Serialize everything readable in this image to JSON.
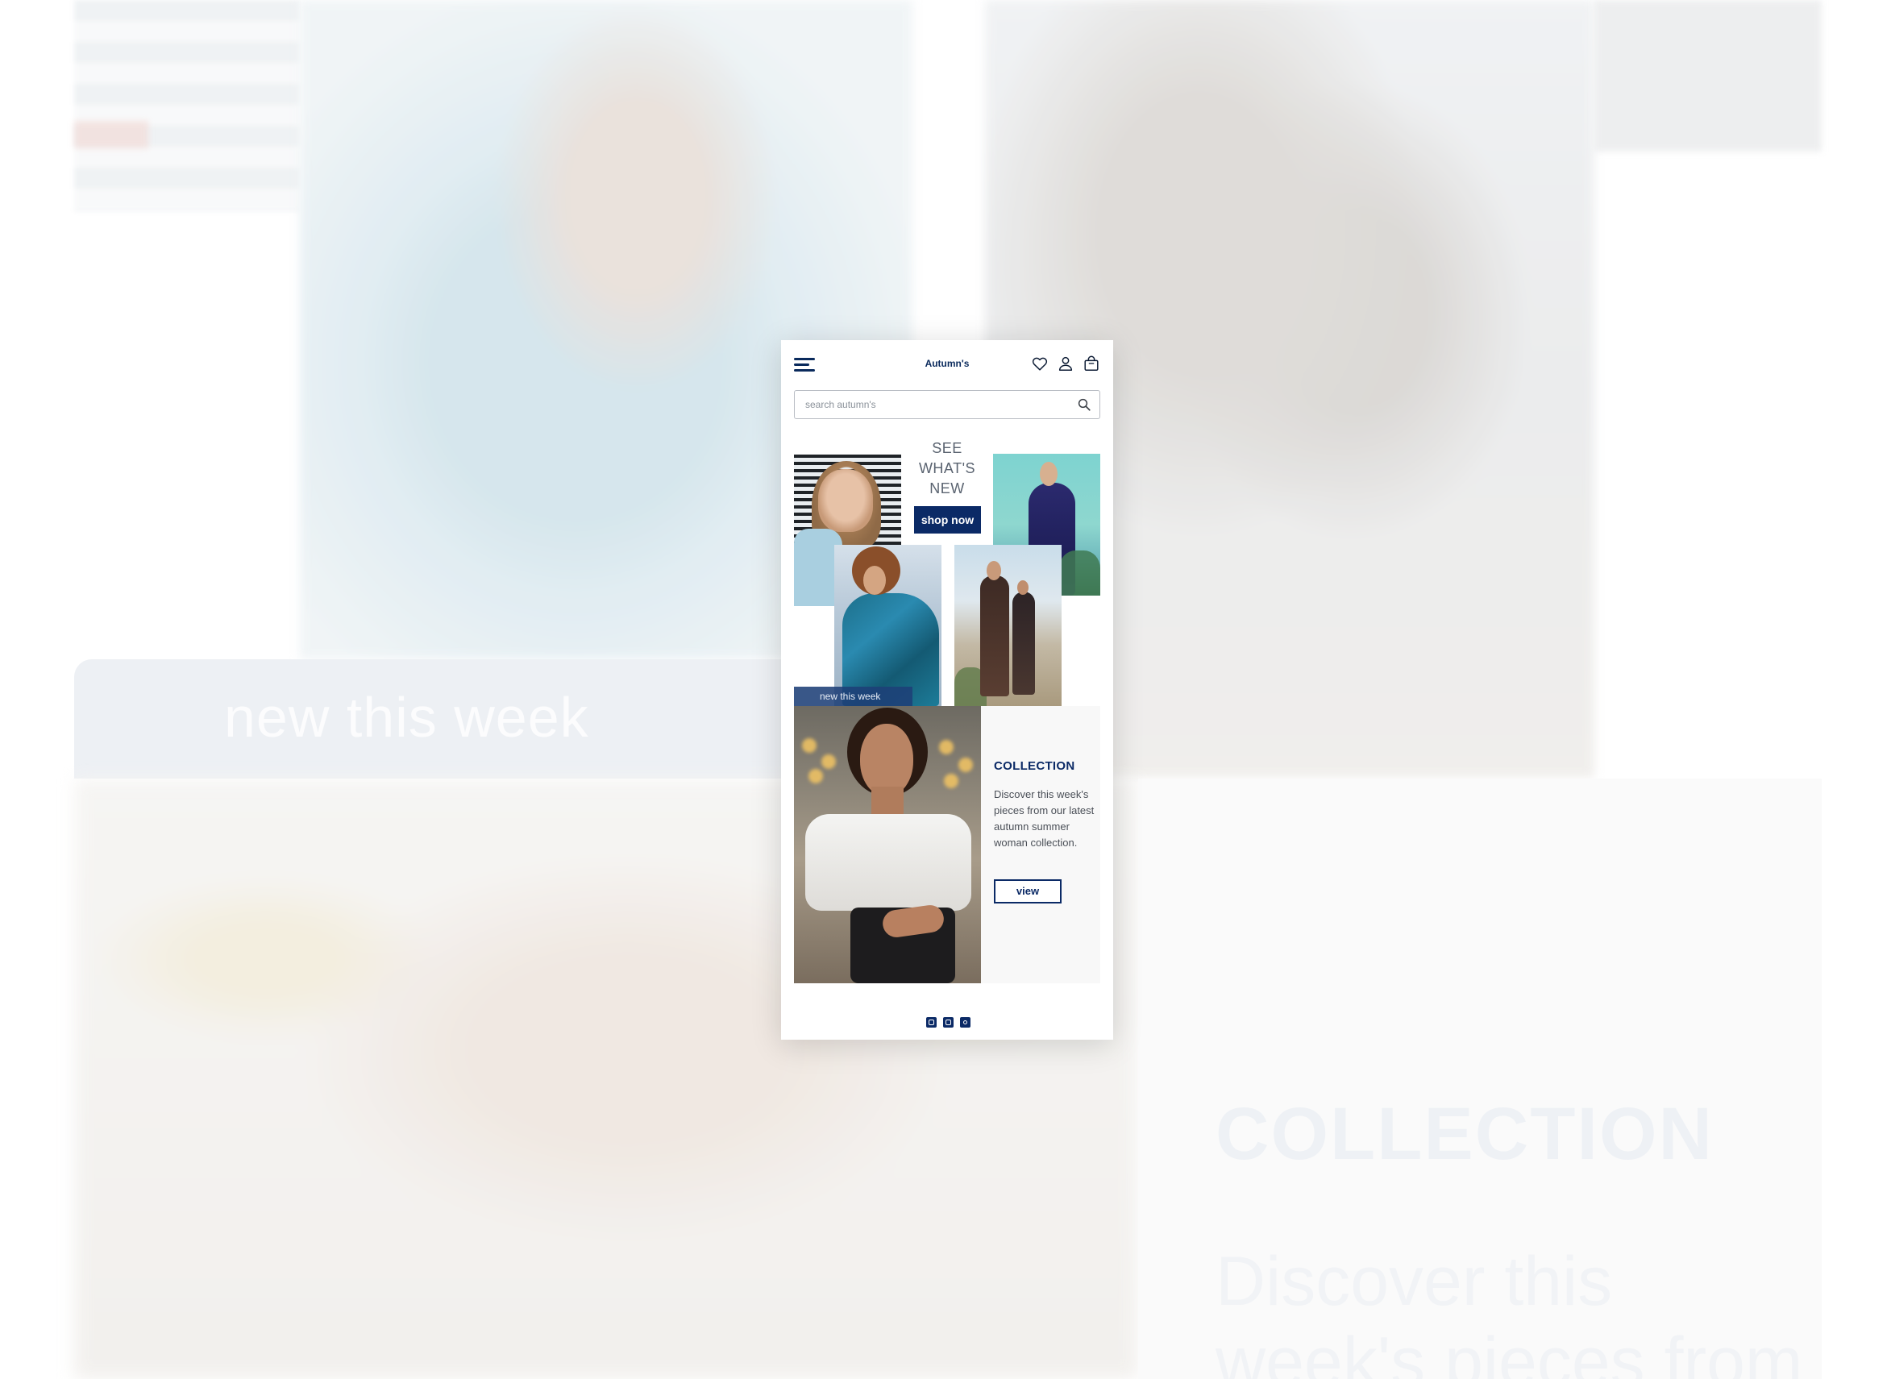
{
  "app": {
    "brand": "Autumn's"
  },
  "search": {
    "placeholder": "search autumn's"
  },
  "hero": {
    "whats_new_lines": [
      "SEE",
      "WHAT'S",
      "NEW"
    ],
    "shop_button": "shop now",
    "new_week_label": "new this week"
  },
  "collection": {
    "title": "COLLECTION",
    "description": "Discover this week's pieces from our latest autumn summer woman collection.",
    "view_button": "view"
  },
  "background": {
    "new_week_text": "new this week",
    "collection_title": "COLLECTION",
    "collection_text_line1": "Discover this",
    "collection_text_line2": "week's pieces from"
  },
  "icons": {
    "menu": "hamburger-menu-icon",
    "wishlist": "heart-icon",
    "account": "user-icon",
    "cart": "shopping-bag-icon",
    "search": "search-icon",
    "social": [
      "facebook-icon",
      "twitter-icon",
      "instagram-icon"
    ]
  },
  "colors": {
    "primary": "#0b2a66",
    "text_muted": "#5a6370",
    "card_bg": "#f8f8f8"
  }
}
